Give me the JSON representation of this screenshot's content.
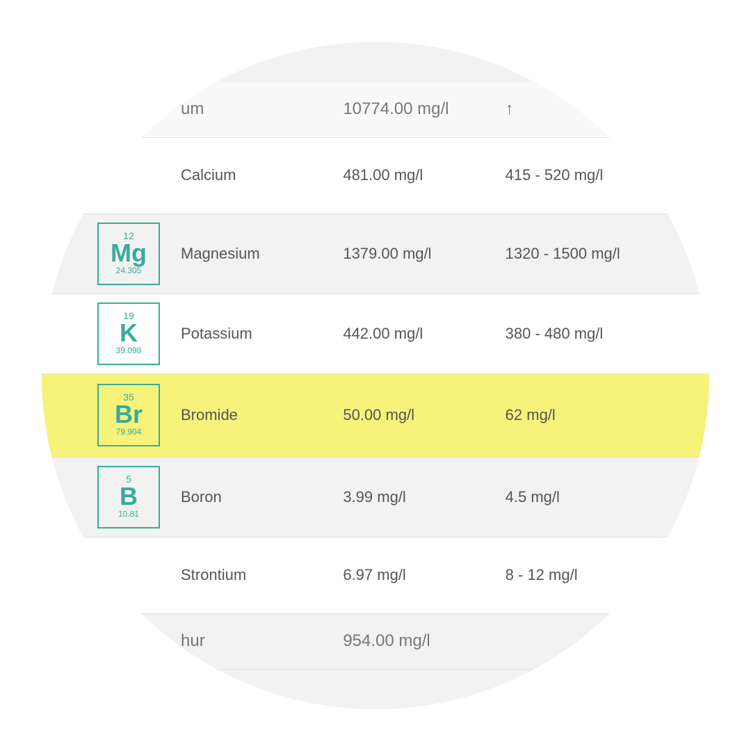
{
  "rows": [
    {
      "id": "sodium-partial",
      "element": null,
      "name_partial": "um",
      "value": "10774.00 mg/l",
      "range": "↑",
      "highlighted": false,
      "partial": "top"
    },
    {
      "id": "calcium",
      "element": {
        "number": "",
        "symbol": "",
        "mass": ""
      },
      "name": "Calcium",
      "value": "481.00 mg/l",
      "range": "415 - 520 mg/l",
      "highlighted": false,
      "showBox": false
    },
    {
      "id": "magnesium",
      "element": {
        "number": "12",
        "symbol": "Mg",
        "mass": "24.305"
      },
      "name": "Magnesium",
      "value": "1379.00 mg/l",
      "range": "1320 - 1500 mg/l",
      "highlighted": false,
      "showBox": true
    },
    {
      "id": "potassium",
      "element": {
        "number": "19",
        "symbol": "K",
        "mass": "39.098"
      },
      "name": "Potassium",
      "value": "442.00 mg/l",
      "range": "380 - 480 mg/l",
      "highlighted": false,
      "showBox": true
    },
    {
      "id": "bromide",
      "element": {
        "number": "35",
        "symbol": "Br",
        "mass": "79.904"
      },
      "name": "Bromide",
      "value": "50.00 mg/l",
      "range": "62 mg/l",
      "highlighted": true,
      "showBox": true
    },
    {
      "id": "boron",
      "element": {
        "number": "5",
        "symbol": "B",
        "mass": "10.81"
      },
      "name": "Boron",
      "value": "3.99 mg/l",
      "range": "4.5 mg/l",
      "highlighted": false,
      "showBox": true
    },
    {
      "id": "strontium",
      "element": null,
      "name": "Strontium",
      "value": "6.97 mg/l",
      "range": "8 - 12 mg/l",
      "highlighted": false,
      "showBox": false
    },
    {
      "id": "sulfur-partial",
      "element": null,
      "name_partial": "hur",
      "value": "954.00 mg/l",
      "range": "",
      "highlighted": false,
      "partial": "bottom"
    }
  ]
}
